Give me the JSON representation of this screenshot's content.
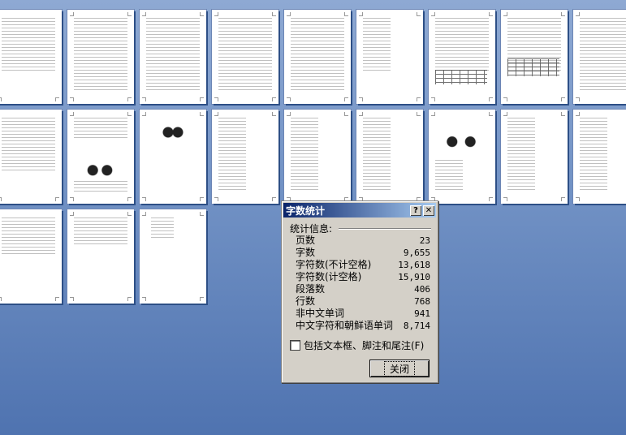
{
  "dialog": {
    "title": "字数统计",
    "help_label": "?",
    "close_x_label": "✕",
    "group_label": "统计信息:",
    "stats": [
      {
        "label": "页数",
        "value": "23"
      },
      {
        "label": "字数",
        "value": "9,655"
      },
      {
        "label": "字符数(不计空格)",
        "value": "13,618"
      },
      {
        "label": "字符数(计空格)",
        "value": "15,910"
      },
      {
        "label": "段落数",
        "value": "406"
      },
      {
        "label": "行数",
        "value": "768"
      },
      {
        "label": "非中文单词",
        "value": "941"
      },
      {
        "label": "中文字符和朝鲜语单词",
        "value": "8,714"
      }
    ],
    "checkbox_label": "包括文本框、脚注和尾注(F)",
    "checkbox_checked": false,
    "close_button_label": "关闭"
  },
  "colors": {
    "background": "#7494c6",
    "titlebar_start": "#0a246a",
    "titlebar_end": "#a6caf0",
    "dialog_face": "#d4d0c8"
  }
}
